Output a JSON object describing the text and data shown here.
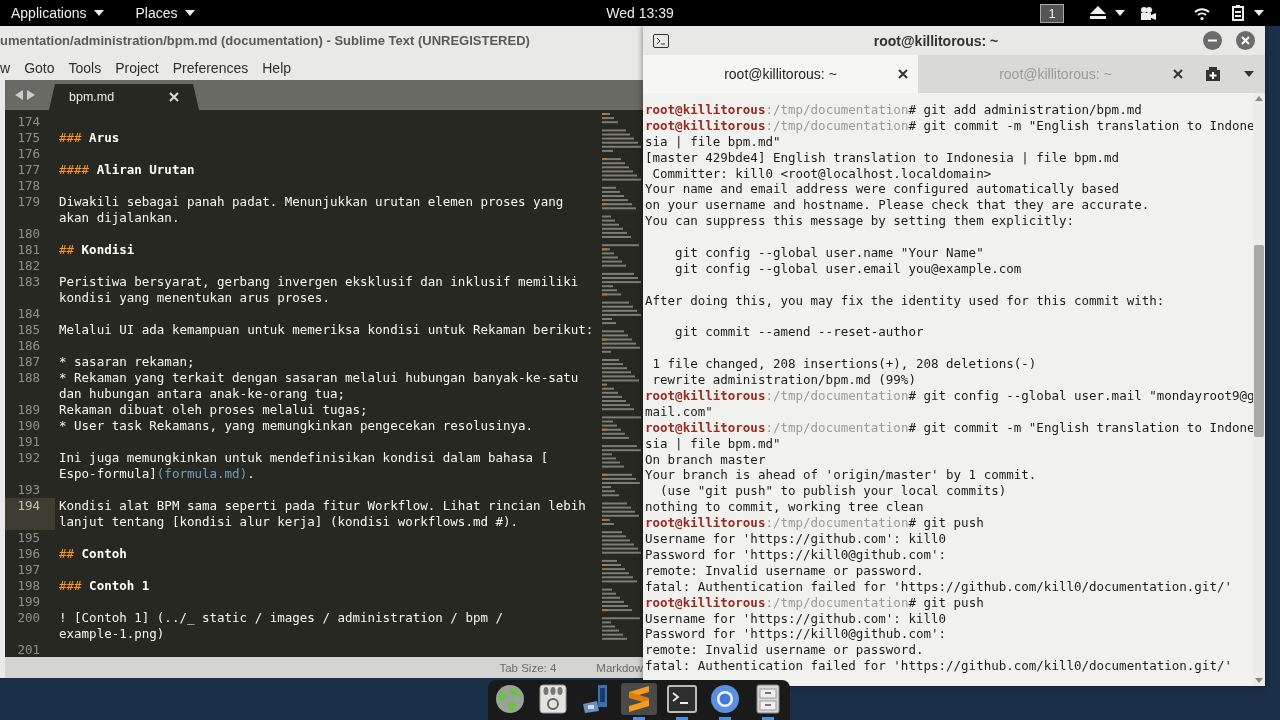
{
  "top_bar": {
    "menus": [
      {
        "label": "Applications"
      },
      {
        "label": "Places"
      }
    ],
    "clock": "Wed 13:39",
    "workspace": "1"
  },
  "sublime": {
    "title": "umentation/administration/bpm.md (documentation) - Sublime Text (UNREGISTERED)",
    "menu": [
      "w",
      "Goto",
      "Tools",
      "Project",
      "Preferences",
      "Help"
    ],
    "tabs": [
      {
        "label": "bpm.md",
        "selected": true
      }
    ],
    "editor": {
      "lines": [
        {
          "number": "174",
          "current": false
        },
        {
          "number": "175",
          "current": false,
          "rows": [
            [
              {
                "text": "### ",
                "kind": "marker"
              },
              {
                "text": "Arus",
                "kind": "heading"
              }
            ]
          ]
        },
        {
          "number": "176",
          "current": false
        },
        {
          "number": "177",
          "current": false,
          "rows": [
            [
              {
                "text": "#### ",
                "kind": "marker"
              },
              {
                "text": "Aliran Urutan",
                "kind": "heading"
              }
            ]
          ]
        },
        {
          "number": "178",
          "current": false
        },
        {
          "number": "179",
          "current": false,
          "rows": [
            [
              {
                "text": "Diwakili sebagai panah padat. Menunjukkan urutan elemen proses yang",
                "kind": "plain"
              }
            ],
            [
              {
                "text": "akan dijalankan.",
                "kind": "plain"
              }
            ]
          ]
        },
        {
          "number": "180",
          "current": false
        },
        {
          "number": "181",
          "current": false,
          "rows": [
            [
              {
                "text": "## ",
                "kind": "marker"
              },
              {
                "text": "Kondisi",
                "kind": "heading"
              }
            ]
          ]
        },
        {
          "number": "182",
          "current": false
        },
        {
          "number": "183",
          "current": false,
          "rows": [
            [
              {
                "text": "Peristiwa bersyarat, gerbang invergen eksklusif dan inklusif memiliki",
                "kind": "plain"
              }
            ],
            [
              {
                "text": "kondisi yang menentukan arus proses.",
                "kind": "plain"
              }
            ]
          ]
        },
        {
          "number": "184",
          "current": false
        },
        {
          "number": "185",
          "current": false,
          "rows": [
            [
              {
                "text": "Melalui UI ada kemampuan untuk memeriksa kondisi untuk Rekaman berikut:",
                "kind": "plain"
              }
            ]
          ]
        },
        {
          "number": "186",
          "current": false
        },
        {
          "number": "187",
          "current": false,
          "rows": [
            [
              {
                "text": "* sasaran rekaman;",
                "kind": "plain"
              }
            ]
          ]
        },
        {
          "number": "188",
          "current": false,
          "rows": [
            [
              {
                "text": "* Rekaman yang terkait dengan sasaran melalui hubungan banyak-ke-satu",
                "kind": "plain"
              }
            ],
            [
              {
                "text": "dan hubungan antara anak-ke-orang tua;",
                "kind": "plain"
              }
            ]
          ]
        },
        {
          "number": "189",
          "current": false,
          "rows": [
            [
              {
                "text": "Rekaman dibuat oleh proses melalui tugas;",
                "kind": "plain"
              }
            ]
          ]
        },
        {
          "number": "190",
          "current": false,
          "rows": [
            [
              {
                "text": "* User task Rekamans, yang memungkinkan pengecekan resolusinya.",
                "kind": "plain"
              }
            ]
          ]
        },
        {
          "number": "191",
          "current": false
        },
        {
          "number": "192",
          "current": false,
          "rows": [
            [
              {
                "text": "Ini juga memungkinkan untuk mendefinisikan kondisi dalam bahasa [",
                "kind": "plain"
              }
            ],
            [
              {
                "text": "Espo-formula]",
                "kind": "plain"
              },
              {
                "text": "(formula.md)",
                "kind": "link"
              },
              {
                "text": ".",
                "kind": "plain"
              }
            ]
          ]
        },
        {
          "number": "193",
          "current": false
        },
        {
          "number": "194",
          "current": true,
          "rows": [
            [
              {
                "text": "Kondisi alat BPM sama seperti pada fitur Workflow. Lihat rincian lebih",
                "kind": "plain"
              }
            ],
            [
              {
                "text": "lanjut tentang [kondisi alur kerja] (kondisi workflows.md #).",
                "kind": "plain"
              }
            ]
          ]
        },
        {
          "number": "195",
          "current": false
        },
        {
          "number": "196",
          "current": false,
          "rows": [
            [
              {
                "text": "## ",
                "kind": "marker"
              },
              {
                "text": "Contoh",
                "kind": "heading"
              }
            ]
          ]
        },
        {
          "number": "197",
          "current": false
        },
        {
          "number": "198",
          "current": false,
          "rows": [
            [
              {
                "text": "### ",
                "kind": "marker"
              },
              {
                "text": "Contoh 1",
                "kind": "heading"
              }
            ]
          ]
        },
        {
          "number": "199",
          "current": false
        },
        {
          "number": "200",
          "current": false,
          "rows": [
            [
              {
                "text": "! [Contoh 1] (../_ static / images / administration / bpm /",
                "kind": "plain"
              }
            ],
            [
              {
                "text": "example-1.png)",
                "kind": "plain"
              }
            ]
          ]
        },
        {
          "number": "201",
          "current": false
        }
      ]
    },
    "status_bar": [
      "Tab Size: 4",
      "Markdow"
    ]
  },
  "terminal": {
    "title": "root@killitorous: ~",
    "tabs": [
      {
        "label": "root@killitorous: ~",
        "selected": true
      },
      {
        "label": "root@killitorous: ~",
        "selected": false
      }
    ],
    "lines": [
      {
        "kind": "prompt",
        "user": "root@killitorous",
        "path": ":/tmp/documentation",
        "command": "# git add administration/bpm.md"
      },
      {
        "kind": "prompt",
        "user": "root@killitorous",
        "path": ":/tmp/documentation",
        "command": "# git commit -m \"English translation to Indone"
      },
      {
        "kind": "output",
        "text": "sia | file bpm.md\""
      },
      {
        "kind": "output",
        "text": "[master 429bde4] English translation to Indonesia | file bpm.md"
      },
      {
        "kind": "output",
        "text": " Committer: kill0 <root@localhost.localdomain>"
      },
      {
        "kind": "output",
        "text": "Your name and email address were configured automatically based"
      },
      {
        "kind": "output",
        "text": "on your username and hostname. Please check that they are accurate."
      },
      {
        "kind": "output",
        "text": "You can suppress this message by setting them explicitly:"
      },
      {
        "kind": "blank"
      },
      {
        "kind": "output",
        "text": "    git config --global user.name \"Your Name\""
      },
      {
        "kind": "output",
        "text": "    git config --global user.email you@example.com"
      },
      {
        "kind": "blank"
      },
      {
        "kind": "output",
        "text": "After doing this, you may fix the identity used for this commit with:"
      },
      {
        "kind": "blank"
      },
      {
        "kind": "output",
        "text": "    git commit --amend --reset-author"
      },
      {
        "kind": "blank"
      },
      {
        "kind": "output",
        "text": " 1 file changed, 208 insertions(+), 208 deletions(-)"
      },
      {
        "kind": "output",
        "text": " rewrite administration/bpm.md (99%)"
      },
      {
        "kind": "prompt",
        "user": "root@killitorous",
        "path": ":/tmp/documentation",
        "command": "# git config --global user.mail \"mondayroot9@g"
      },
      {
        "kind": "output",
        "text": "mail.com\""
      },
      {
        "kind": "prompt",
        "user": "root@killitorous",
        "path": ":/tmp/documentation",
        "command": "# git commit -m \"English translation to Indone"
      },
      {
        "kind": "output",
        "text": "sia | file bpm.md\""
      },
      {
        "kind": "output",
        "text": "On branch master"
      },
      {
        "kind": "output",
        "text": "Your branch is ahead of 'origin/master' by 1 commit."
      },
      {
        "kind": "output",
        "text": "  (use \"git push\" to publish your local commits)"
      },
      {
        "kind": "output",
        "text": "nothing to commit, working tree clean"
      },
      {
        "kind": "prompt",
        "user": "root@killitorous",
        "path": ":/tmp/documentation",
        "command": "# git push"
      },
      {
        "kind": "output",
        "text": "Username for 'https://github.com': kill0"
      },
      {
        "kind": "output",
        "text": "Password for 'https://kill0@github.com':"
      },
      {
        "kind": "output",
        "text": "remote: Invalid username or password."
      },
      {
        "kind": "output",
        "text": "fatal: Authentication failed for 'https://github.com/kill0/documentation.git/'"
      },
      {
        "kind": "prompt",
        "user": "root@killitorous",
        "path": ":/tmp/documentation",
        "command": "# git push"
      },
      {
        "kind": "output",
        "text": "Username for 'https://github.com': kill0"
      },
      {
        "kind": "output",
        "text": "Password for 'https://kill0@github.com':"
      },
      {
        "kind": "output",
        "text": "remote: Invalid username or password."
      },
      {
        "kind": "output",
        "text": "fatal: Authentication failed for 'https://github.com/kill0/documentation.git/'"
      }
    ]
  },
  "dock": {
    "items": [
      {
        "running": false,
        "active": false
      },
      {
        "running": false,
        "active": false
      },
      {
        "running": false,
        "active": false
      },
      {
        "running": true,
        "active": true
      },
      {
        "running": true,
        "active": false
      },
      {
        "running": true,
        "active": false
      },
      {
        "running": true,
        "active": false
      }
    ]
  }
}
